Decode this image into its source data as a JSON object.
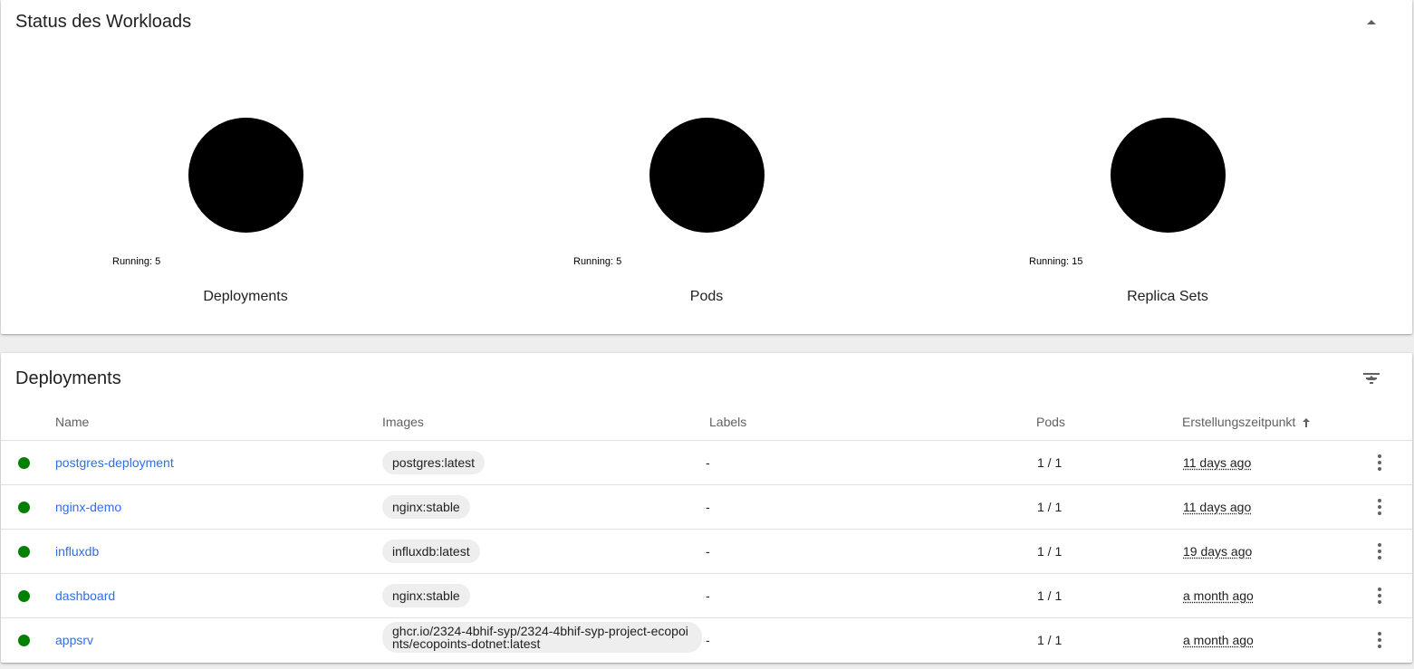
{
  "workload_status": {
    "title": "Status des Workloads",
    "items": [
      {
        "label": "Deployments",
        "running_text": "Running: 5",
        "running": 5
      },
      {
        "label": "Pods",
        "running_text": "Running: 5",
        "running": 5
      },
      {
        "label": "Replica Sets",
        "running_text": "Running: 15",
        "running": 15
      }
    ]
  },
  "deployments": {
    "title": "Deployments",
    "columns": {
      "name": "Name",
      "images": "Images",
      "labels": "Labels",
      "pods": "Pods",
      "created": "Erstellungszeitpunkt"
    },
    "rows": [
      {
        "status": "running",
        "name": "postgres-deployment",
        "image": "postgres:latest",
        "labels": "-",
        "pods": "1 / 1",
        "created": "11 days ago"
      },
      {
        "status": "running",
        "name": "nginx-demo",
        "image": "nginx:stable",
        "labels": "-",
        "pods": "1 / 1",
        "created": "11 days ago"
      },
      {
        "status": "running",
        "name": "influxdb",
        "image": "influxdb:latest",
        "labels": "-",
        "pods": "1 / 1",
        "created": "19 days ago"
      },
      {
        "status": "running",
        "name": "dashboard",
        "image": "nginx:stable",
        "labels": "-",
        "pods": "1 / 1",
        "created": "a month ago"
      },
      {
        "status": "running",
        "name": "appsrv",
        "image": "ghcr.io/2324-4bhif-syp/2324-4bhif-syp-project-ecopoints/ecopoints-dotnet:latest",
        "labels": "-",
        "pods": "1 / 1",
        "created": "a month ago"
      }
    ]
  },
  "colors": {
    "status_running": "#008000",
    "link": "#326de6",
    "chart_fill": "#000000"
  },
  "icons": {
    "collapse": "chevron-up-icon",
    "filter": "filter-icon",
    "sort": "arrow-up-icon",
    "row_menu": "more-vert-icon"
  }
}
